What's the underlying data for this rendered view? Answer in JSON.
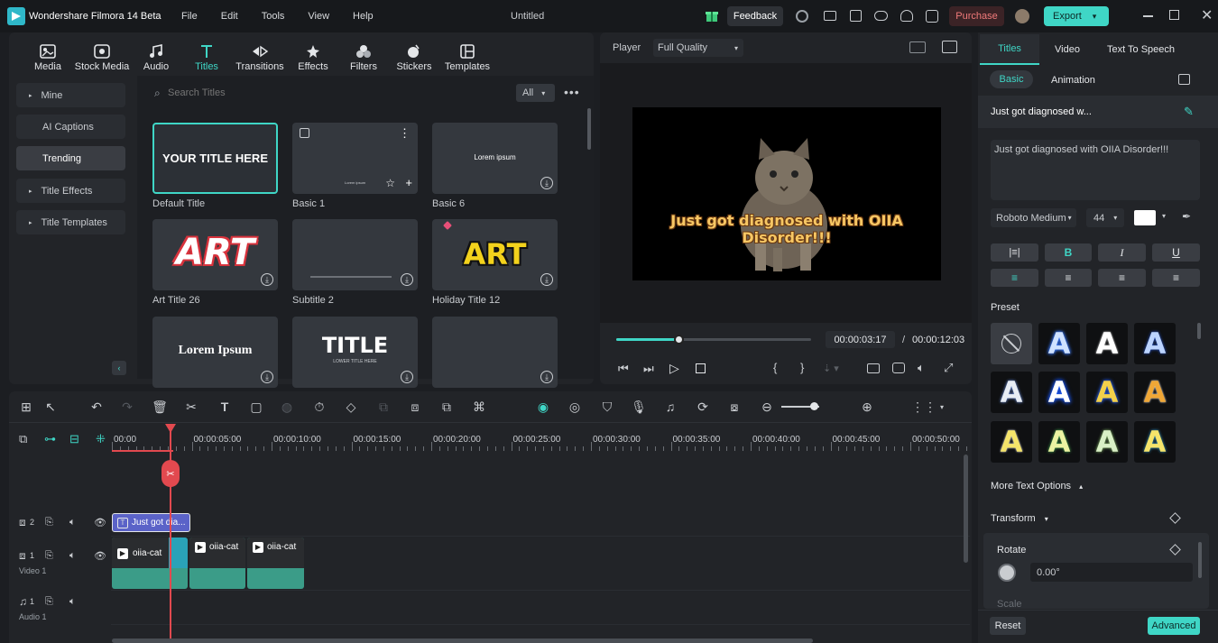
{
  "app": {
    "title": "Wondershare Filmora 14 Beta",
    "project": "Untitled"
  },
  "menu": [
    "File",
    "Edit",
    "Tools",
    "View",
    "Help"
  ],
  "header": {
    "feedback": "Feedback",
    "purchase": "Purchase",
    "export": "Export"
  },
  "media_tabs": [
    {
      "label": "Media",
      "icon": "media-icon"
    },
    {
      "label": "Stock Media",
      "icon": "stock-media-icon"
    },
    {
      "label": "Audio",
      "icon": "audio-icon"
    },
    {
      "label": "Titles",
      "icon": "titles-icon",
      "active": true
    },
    {
      "label": "Transitions",
      "icon": "transitions-icon"
    },
    {
      "label": "Effects",
      "icon": "effects-icon"
    },
    {
      "label": "Filters",
      "icon": "filters-icon"
    },
    {
      "label": "Stickers",
      "icon": "stickers-icon"
    },
    {
      "label": "Templates",
      "icon": "templates-icon"
    }
  ],
  "sidebar": [
    {
      "label": "Mine",
      "arrow": true
    },
    {
      "label": "AI Captions",
      "arrow": false
    },
    {
      "label": "Trending",
      "arrow": false,
      "active": true
    },
    {
      "label": "Title Effects",
      "arrow": true
    },
    {
      "label": "Title Templates",
      "arrow": true
    }
  ],
  "search": {
    "placeholder": "Search Titles",
    "filter": "All"
  },
  "cards": [
    {
      "label": "Default Title",
      "preview": "YOUR TITLE HERE"
    },
    {
      "label": "Basic 1",
      "preview": "Lorem ipsum"
    },
    {
      "label": "Basic 6",
      "preview": "Lorem ipsum"
    },
    {
      "label": "Art Title 26",
      "preview": "ART"
    },
    {
      "label": "Subtitle 2",
      "preview": ""
    },
    {
      "label": "Holiday Title 12",
      "preview": "ART"
    },
    {
      "label": "",
      "preview": "Lorem Ipsum"
    },
    {
      "label": "",
      "preview": "TITLE",
      "sub": "LOWER TITLE HERE"
    },
    {
      "label": "",
      "preview": ""
    }
  ],
  "player": {
    "label": "Player",
    "quality": "Full Quality",
    "overlay_text": "Just got diagnosed with OIIA Disorder!!!",
    "current": "00:00:03:17",
    "separator": "/",
    "total": "00:00:12:03",
    "progress": 0.32
  },
  "inspector": {
    "tabs": [
      "Titles",
      "Video",
      "Text To Speech"
    ],
    "subtabs": [
      "Basic",
      "Animation"
    ],
    "title_name": "Just got diagnosed w...",
    "text": "Just got diagnosed with OIIA Disorder!!!",
    "font": "Roboto Medium",
    "size": "44",
    "color": "#ffffff",
    "preset_label": "Preset",
    "more_options": "More Text Options",
    "transform": "Transform",
    "rotate": "Rotate",
    "rotate_value": "0.00°",
    "scale": "Scale",
    "reset": "Reset",
    "advanced": "Advanced"
  },
  "timeline": {
    "ruler": [
      "00:00",
      "00:00:05:00",
      "00:00:10:00",
      "00:00:15:00",
      "00:00:20:00",
      "00:00:25:00",
      "00:00:30:00",
      "00:00:35:00",
      "00:00:40:00",
      "00:00:45:00",
      "00:00:50:00"
    ],
    "tracks": [
      {
        "num": "2",
        "label": ""
      },
      {
        "num": "1",
        "label": "Video 1"
      },
      {
        "num": "1",
        "label": "Audio 1"
      }
    ],
    "title_clip": "Just got dia...",
    "video_clips": [
      "oiia-cat",
      "oiia-cat",
      "oiia-cat"
    ]
  },
  "colors": {
    "accent": "#3fd6c6",
    "purchase": "#e05a5a",
    "playhead": "#e2494f"
  }
}
